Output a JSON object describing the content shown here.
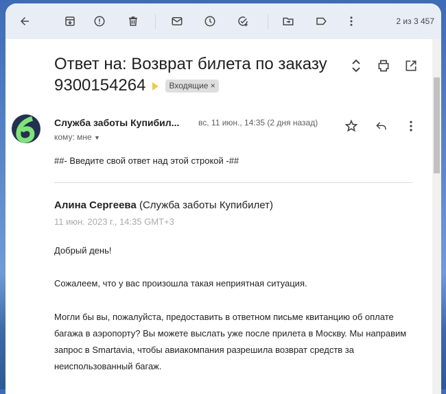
{
  "toolbar": {
    "counter": "2 из 3 457",
    "icons": [
      "back-arrow-icon",
      "archive-icon",
      "report-spam-icon",
      "delete-icon",
      "mark-unread-icon",
      "snooze-icon",
      "add-task-icon",
      "move-to-icon",
      "label-icon",
      "more-icon"
    ]
  },
  "subject": {
    "line1": "Ответ на: Возврат билета по заказу",
    "line2": "9300154264",
    "label": "Входящие",
    "label_close": "×"
  },
  "message": {
    "sender": "Служба заботы Купибил...",
    "date": "вс, 11 июн., 14:35 (2 дня назад)",
    "to": "кому: мне",
    "reply_line": "##- Введите свой ответ над этой строкой -##",
    "author_name": "Алина Сергеева",
    "author_org": " (Служба заботы Купибилет)",
    "author_date": "11 июн. 2023 г., 14:35 GMT+3",
    "paragraphs": [
      "Добрый день!",
      "Сожалеем, что у вас произошла такая неприятная ситуация.",
      "Могли бы вы, пожалуйста, предоставить в ответном письме квитанцию об оплате багажа в аэропорту? Вы можете выслать уже после прилета в Москву. Мы направим запрос в Smartavia, чтобы авиакомпания разрешила возврат средств за неиспользованный багаж."
    ]
  },
  "colors": {
    "toolbar": "#e9eef6",
    "avatar_bg": "#24304f",
    "avatar_fg": "#7fe37a",
    "important": "#f2c84b"
  }
}
